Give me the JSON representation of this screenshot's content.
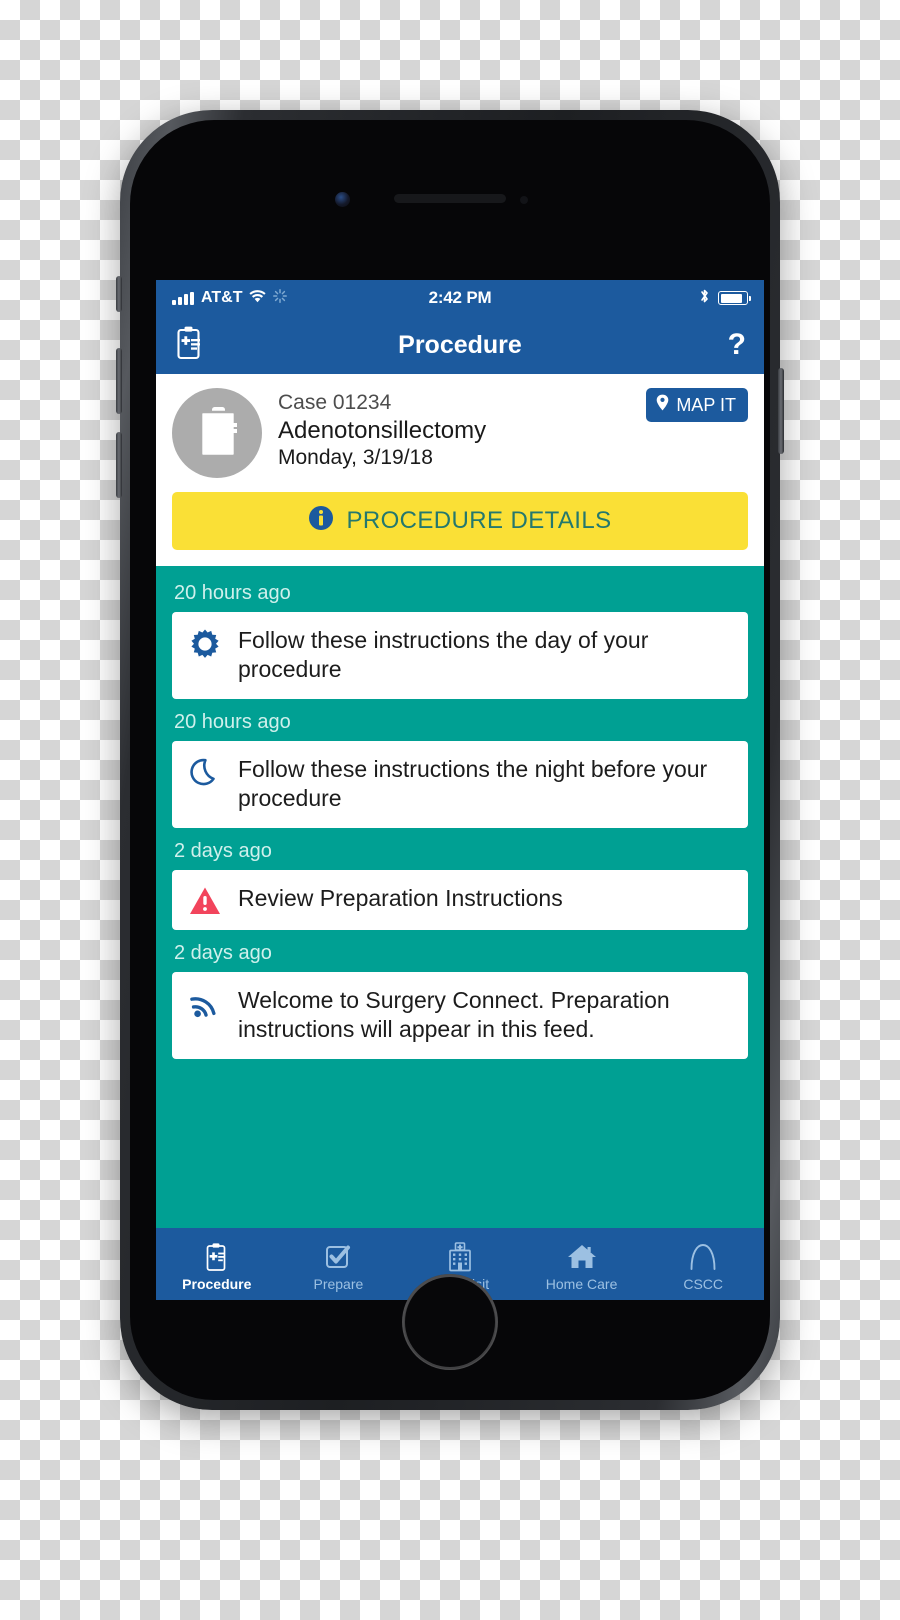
{
  "status_bar": {
    "carrier": "AT&T",
    "time": "2:42 PM",
    "signal_icon": "signal-bars-icon",
    "wifi_icon": "wifi-icon",
    "sync_icon": "sync-spinner-icon",
    "bluetooth_icon": "bluetooth-icon",
    "battery_icon": "battery-icon"
  },
  "nav": {
    "left_icon": "clipboard-medical-icon",
    "title": "Procedure",
    "help_label": "?"
  },
  "case": {
    "avatar_icon": "clipboard-medical-icon",
    "case_id": "Case 01234",
    "procedure_name": "Adenotonsillectomy",
    "date": "Monday, 3/19/18",
    "map_it_label": "MAP IT",
    "map_it_icon": "location-pin-icon",
    "details_label": "PROCEDURE DETAILS",
    "details_icon": "info-circle-icon"
  },
  "feed": {
    "items": [
      {
        "timestamp": "20 hours ago",
        "icon": "sun-icon",
        "text": "Follow these instructions the day of your procedure"
      },
      {
        "timestamp": "20 hours ago",
        "icon": "moon-icon",
        "text": "Follow these instructions the night before your procedure"
      },
      {
        "timestamp": "2 days ago",
        "icon": "warning-triangle-icon",
        "text": "Review Preparation Instructions"
      },
      {
        "timestamp": "2 days ago",
        "icon": "rss-feed-icon",
        "text": "Welcome to Surgery Connect. Preparation instructions will appear in this feed."
      }
    ]
  },
  "tabbar": {
    "tabs": [
      {
        "label": "Procedure",
        "icon": "clipboard-medical-icon",
        "active": true
      },
      {
        "label": "Prepare",
        "icon": "checkbox-check-icon",
        "active": false
      },
      {
        "label": "Your Visit",
        "icon": "hospital-building-icon",
        "active": false
      },
      {
        "label": "Home Care",
        "icon": "house-icon",
        "active": false
      },
      {
        "label": "CSCC",
        "icon": "arch-logo-icon",
        "active": false
      }
    ]
  },
  "colors": {
    "brand_blue": "#1C5A9E",
    "teal": "#00A093",
    "yellow": "#FAE036",
    "details_text": "#24786E",
    "warning_red": "#F2445C",
    "avatar_gray": "#ACACAC",
    "timestamp": "#CFF0EC"
  }
}
